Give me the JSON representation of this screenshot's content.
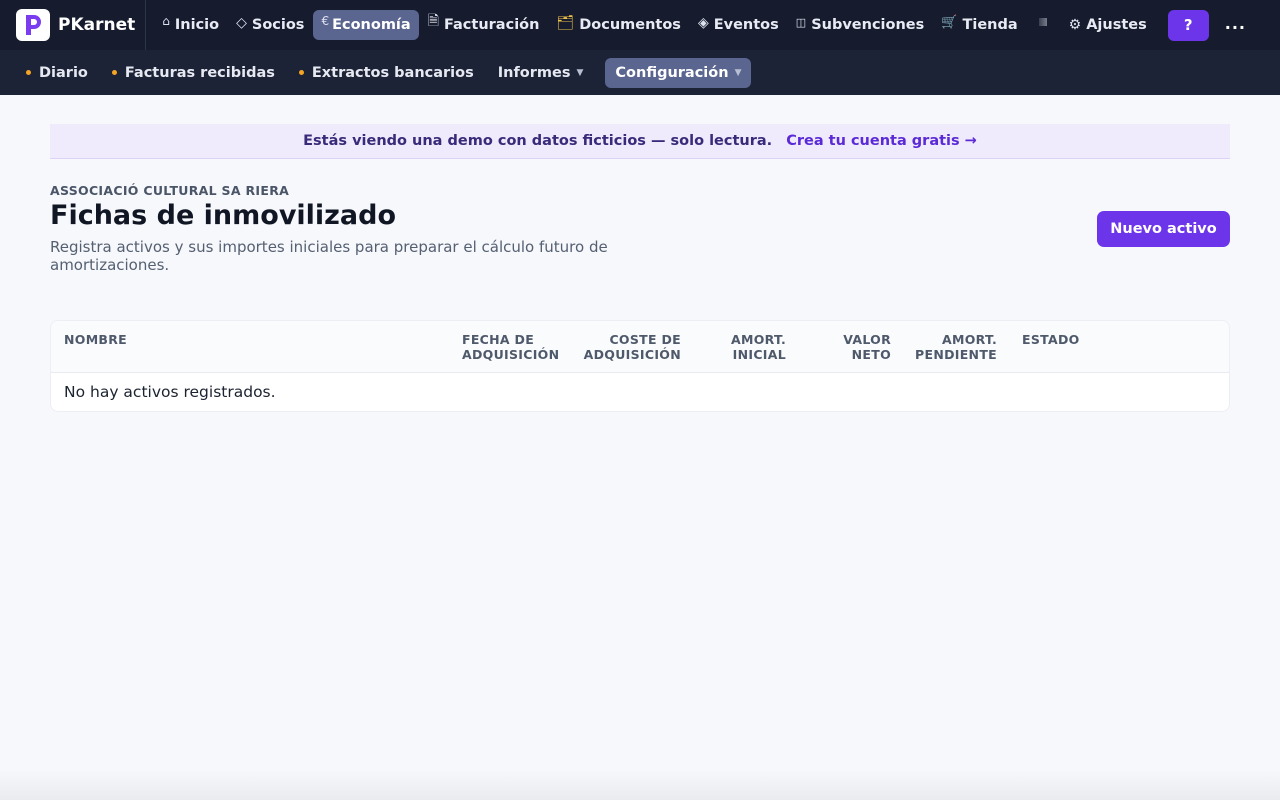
{
  "app": {
    "name": "PKarnet"
  },
  "topnav": {
    "items": [
      {
        "label": "Inicio",
        "icon": "home-icon",
        "glyph": "⌂"
      },
      {
        "label": "Socios",
        "icon": "diamond-icon",
        "glyph": "◇"
      },
      {
        "label": "Economía",
        "icon": "euro-icon",
        "glyph": "€",
        "active": true
      },
      {
        "label": "Facturación",
        "icon": "receipt-icon",
        "glyph": "🗎"
      },
      {
        "label": "Documentos",
        "icon": "folder-icon",
        "glyph": "🗂"
      },
      {
        "label": "Eventos",
        "icon": "event-diamond-icon",
        "glyph": "◈"
      },
      {
        "label": "Subvenciones",
        "icon": "book-icon",
        "glyph": "◫"
      },
      {
        "label": "Tienda",
        "icon": "cart-icon",
        "glyph": "🛒"
      },
      {
        "label": "Ajustes",
        "icon": "gear-icon",
        "glyph": "⚙"
      }
    ],
    "help_label": "?",
    "more_label": "..."
  },
  "subnav": {
    "items": [
      {
        "label": "Diario"
      },
      {
        "label": "Facturas recibidas"
      },
      {
        "label": "Extractos bancarios"
      },
      {
        "label": "Informes"
      },
      {
        "label": "Configuración",
        "active": true
      }
    ]
  },
  "banner": {
    "text": "Estás viendo una demo con datos ficticios — solo lectura.",
    "link": "Crea tu cuenta gratis →"
  },
  "page": {
    "organization": "ASSOCIACIÓ CULTURAL SA RIERA",
    "title": "Fichas de inmovilizado",
    "description": "Registra activos y sus importes iniciales para preparar el cálculo futuro de amortizaciones.",
    "new_button": "Nuevo activo"
  },
  "table": {
    "columns": [
      {
        "line1": "NOMBRE",
        "line2": ""
      },
      {
        "line1": "FECHA DE",
        "line2": "ADQUISICIÓN"
      },
      {
        "line1": "COSTE DE",
        "line2": "ADQUISICIÓN"
      },
      {
        "line1": "AMORT.",
        "line2": "INICIAL"
      },
      {
        "line1": "VALOR",
        "line2": "NETO"
      },
      {
        "line1": "AMORT.",
        "line2": "PENDIENTE"
      },
      {
        "line1": "ESTADO",
        "line2": ""
      }
    ],
    "empty_message": "No hay activos registrados."
  },
  "colors": {
    "topbar": "#161c2e",
    "subbar": "#1c2337",
    "accent": "#6d35ea",
    "active_nav": "#5a6690",
    "banner_bg": "#efeafc"
  }
}
